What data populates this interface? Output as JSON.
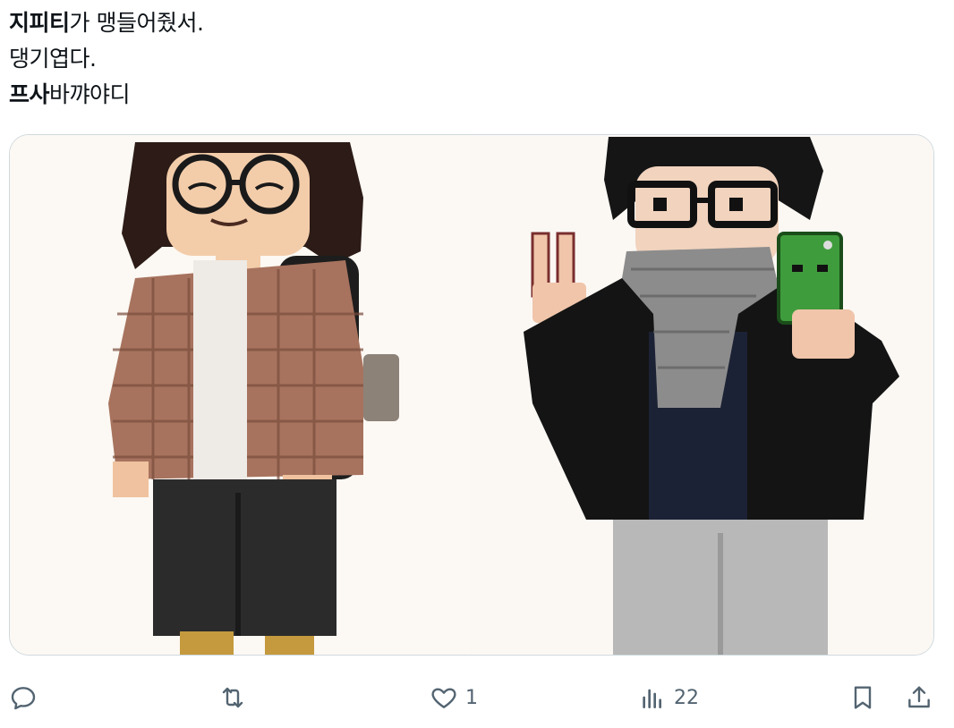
{
  "post": {
    "lines": [
      {
        "bold": "지피티",
        "rest": "가 맹들어줬서."
      },
      {
        "bold": "",
        "rest": "댕기엽다."
      },
      {
        "bold": "프사",
        "rest": "바꺄야디"
      }
    ]
  },
  "media": {
    "images": [
      {
        "name": "pixel-art-character-1"
      },
      {
        "name": "pixel-art-character-2"
      }
    ]
  },
  "actions": {
    "reply": {
      "icon": "reply-icon",
      "count": ""
    },
    "repost": {
      "icon": "repost-icon",
      "count": ""
    },
    "like": {
      "icon": "heart-icon",
      "count": "1"
    },
    "views": {
      "icon": "views-chart-icon",
      "count": "22"
    },
    "bookmark": {
      "icon": "bookmark-icon"
    },
    "share": {
      "icon": "share-icon"
    }
  },
  "colors": {
    "text": "#0f1419",
    "muted": "#536471",
    "border": "#cfd9de"
  }
}
